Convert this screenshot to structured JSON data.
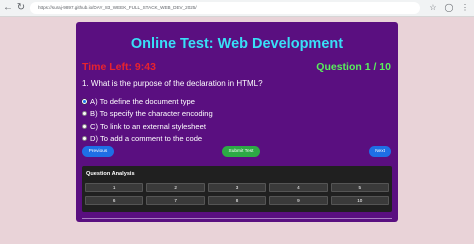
{
  "browser": {
    "url": "https://suraj-9897.github.io/DAY_83_WEEK_FULL_STACK_WEB_DEV_2025/"
  },
  "quiz": {
    "title": "Online Test: Web Development",
    "timer": "Time Left: 9:43",
    "question_counter": "Question 1 / 10",
    "question": "1. What is the purpose of the declaration in HTML?",
    "options": [
      {
        "label": "A) To define the document type",
        "selected": true
      },
      {
        "label": "B) To specify the character encoding",
        "selected": false
      },
      {
        "label": "C) To link to an external stylesheet",
        "selected": false
      },
      {
        "label": "D) To add a comment to the code",
        "selected": false
      }
    ],
    "buttons": {
      "previous": "Previous",
      "submit": "Submit Test",
      "next": "Next"
    },
    "analysis": {
      "title": "Question Analysis",
      "numbers": [
        "1",
        "2",
        "3",
        "4",
        "5",
        "6",
        "7",
        "8",
        "9",
        "10"
      ]
    }
  },
  "colors": {
    "panel": "#5a0f80",
    "title": "#38e0f7",
    "timer": "#e8232e",
    "counter": "#58f05a",
    "button_blue": "#1e6fe6",
    "button_green": "#2daa45"
  }
}
